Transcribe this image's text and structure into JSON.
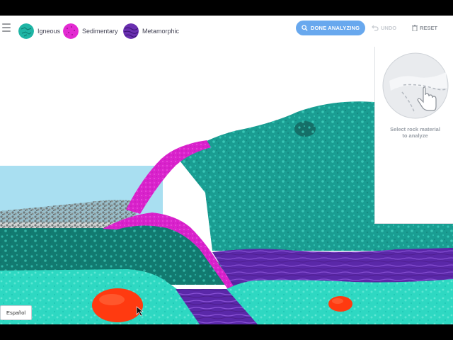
{
  "legend": {
    "items": [
      {
        "label": "Igneous",
        "color": "#1fb5a5"
      },
      {
        "label": "Sedimentary",
        "color": "#e32bd2"
      },
      {
        "label": "Metamorphic",
        "color": "#6a2fb0"
      }
    ]
  },
  "toolbar": {
    "menu_icon": "hamburger-menu-icon",
    "done_label": "DONE ANALYZING",
    "done_icon": "search-icon",
    "undo_label": "UNDO",
    "undo_icon": "undo-arrow-icon",
    "reset_label": "RESET",
    "reset_icon": "trash-icon",
    "accent_color": "#68a8ee"
  },
  "side_panel": {
    "instruction": "Select rock material\nto analyze",
    "illustration_icon": "pointing-hand-icon"
  },
  "language_button": {
    "label": "Español"
  },
  "scene": {
    "features": [
      "sky",
      "ocean",
      "gravel-beach",
      "igneous-mountain",
      "sedimentary-layer",
      "metamorphic-layer",
      "igneous-bedrock",
      "magma-blob"
    ]
  }
}
